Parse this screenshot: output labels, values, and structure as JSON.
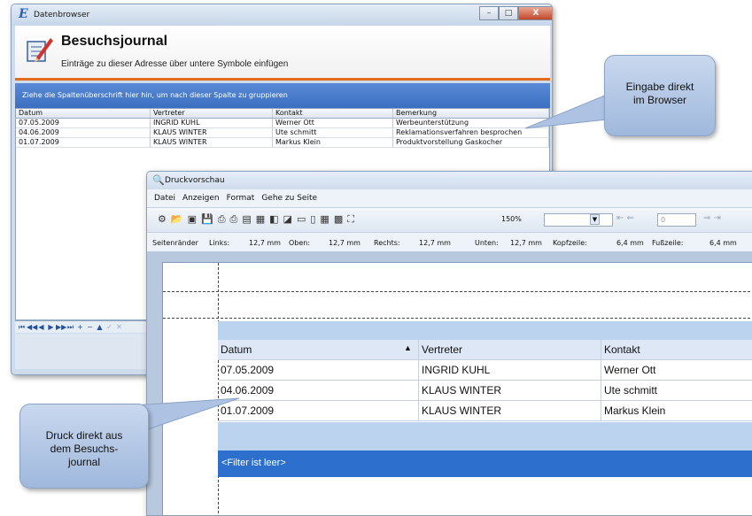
{
  "colors": {
    "accent_orange": "#e36b1c",
    "group_bar_blue": "#3c6fc2",
    "filter_bar_blue": "#2d6fcc",
    "callout_blue": "#b3c8e6"
  },
  "browser_window": {
    "title": "Datenbrowser",
    "app_logo": "E",
    "heading": "Besuchsjournal",
    "subheading": "Einträge zu dieser Adresse über untere Symbole einfügen",
    "group_hint": "Ziehe die Spaltenüberschrift hier hin, um nach dieser Spalte zu gruppieren",
    "columns": [
      "Datum",
      "Vertreter",
      "Kontakt",
      "Bemerkung"
    ],
    "rows": [
      [
        "07.05.2009",
        "INGRID KUHL",
        "Werner Ott",
        "Werbeunterstützung"
      ],
      [
        "04.06.2009",
        "KLAUS WINTER",
        "Ute schmitt",
        "Reklamationsverfahren besprochen"
      ],
      [
        "01.07.2009",
        "KLAUS WINTER",
        "Markus Klein",
        "Produktvorstellung Gaskocher"
      ]
    ],
    "nav_buttons": [
      "⏮",
      "◀◀",
      "◀",
      "▶",
      "▶▶",
      "⏭",
      "+",
      "−",
      "▲",
      "✓",
      "✕"
    ],
    "window_buttons": [
      "–",
      "□",
      "X"
    ]
  },
  "callout_browser": {
    "line1": "Eingabe direkt",
    "line2": "im Browser"
  },
  "preview_window": {
    "title": "Druckvorschau",
    "menu": [
      "Datei",
      "Anzeigen",
      "Format",
      "Gehe zu Seite"
    ],
    "zoom_value": "150%",
    "page_value": "0",
    "margins": {
      "label": "Seitenränder",
      "links_label": "Links:",
      "links_value": "12,7 mm",
      "oben_label": "Oben:",
      "oben_value": "12,7 mm",
      "rechts_label": "Rechts:",
      "rechts_value": "12,7 mm",
      "unten_label": "Unten:",
      "unten_value": "12,7 mm",
      "kopf_label": "Kopfzeile:",
      "kopf_value": "6,4 mm",
      "fuss_label": "Fußzeile:",
      "fuss_value": "6,4 mm"
    },
    "columns": [
      "Datum",
      "Vertreter",
      "Kontakt"
    ],
    "sort_indicator": "▲",
    "rows": [
      [
        "07.05.2009",
        "INGRID KUHL",
        "Werner Ott"
      ],
      [
        "04.06.2009",
        "KLAUS WINTER",
        "Ute schmitt"
      ],
      [
        "01.07.2009",
        "KLAUS WINTER",
        "Markus Klein"
      ]
    ],
    "filter_text": "<Filter ist leer>"
  },
  "callout_print": {
    "line1": "Druck direkt aus",
    "line2": "dem Besuchs-",
    "line3": "journal"
  }
}
